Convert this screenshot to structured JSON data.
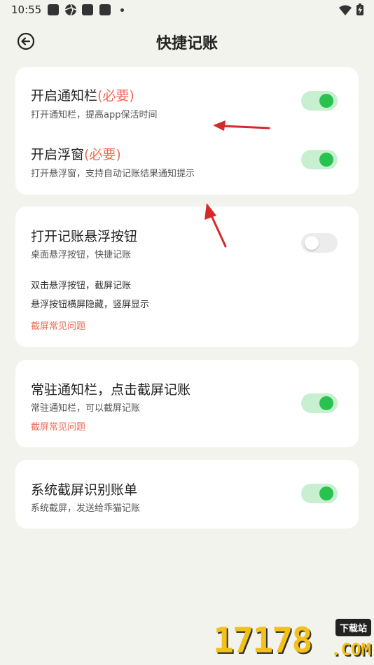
{
  "status_bar": {
    "time": "10:55",
    "icons": [
      "notification-square-icon",
      "aperture-icon",
      "notification-square-icon",
      "notification-square-icon",
      "dot-icon",
      "wifi-icon",
      "battery-charging-icon"
    ]
  },
  "header": {
    "title": "快捷记账",
    "back_icon": "back-arrow-circle-icon"
  },
  "card1": {
    "row1": {
      "title": "开启通知栏",
      "required": "(必要)",
      "subtitle": "打开通知栏，提高app保活时间",
      "toggle_on": true
    },
    "row2": {
      "title": "开启浮窗",
      "required": "(必要)",
      "subtitle": "打开悬浮窗，支持自动记账结果通知提示",
      "toggle_on": true
    }
  },
  "card2": {
    "title": "打开记账悬浮按钮",
    "subtitle": "桌面悬浮按钮，快捷记账",
    "toggle_on": false,
    "note1": "双击悬浮按钮，截屏记账",
    "note2": "悬浮按钮横屏隐藏，竖屏显示",
    "link": "截屏常见问题"
  },
  "card3": {
    "title": "常驻通知栏，点击截屏记账",
    "subtitle": "常驻通知栏，可以截屏记账",
    "toggle_on": true,
    "link": "截屏常见问题"
  },
  "card4": {
    "title": "系统截屏识别账单",
    "subtitle": "系统截屏，发送给乖猫记账",
    "toggle_on": true
  },
  "watermark": {
    "number": "17178",
    "badge": "下载站",
    "domain": ".COM"
  },
  "colors": {
    "background": "#f3f3ed",
    "accent_red": "#ef6a55",
    "toggle_green": "#29c24f",
    "toggle_track": "#c8efcf"
  }
}
